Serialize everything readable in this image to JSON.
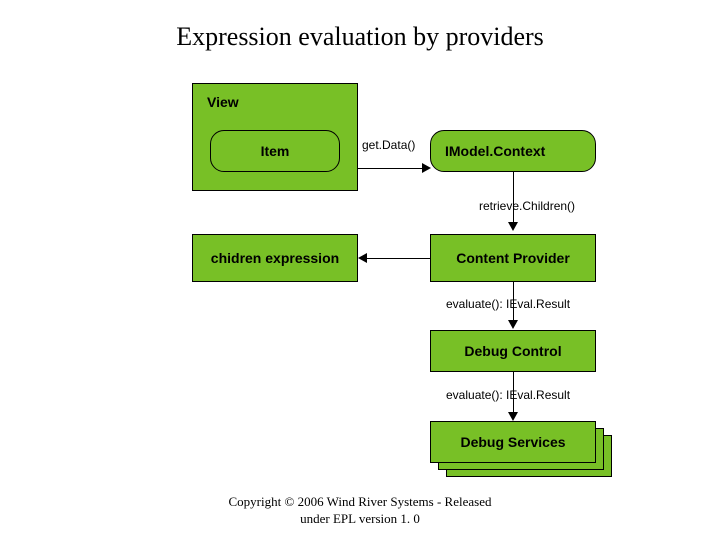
{
  "title": "Expression evaluation by providers",
  "boxes": {
    "view": "View",
    "item": "Item",
    "imodel": "IModel.Context",
    "children_expr": "chidren expression",
    "content_provider": "Content Provider",
    "debug_control": "Debug Control",
    "debug_services": "Debug Services"
  },
  "labels": {
    "get_data": "get.Data()",
    "retrieve_children": "retrieve.Children()",
    "evaluate1": "evaluate(): IEval.Result",
    "evaluate2": "evaluate(): IEval.Result"
  },
  "footer_l1": "Copyright © 2006 Wind River Systems - Released",
  "footer_l2": "under EPL version 1. 0"
}
